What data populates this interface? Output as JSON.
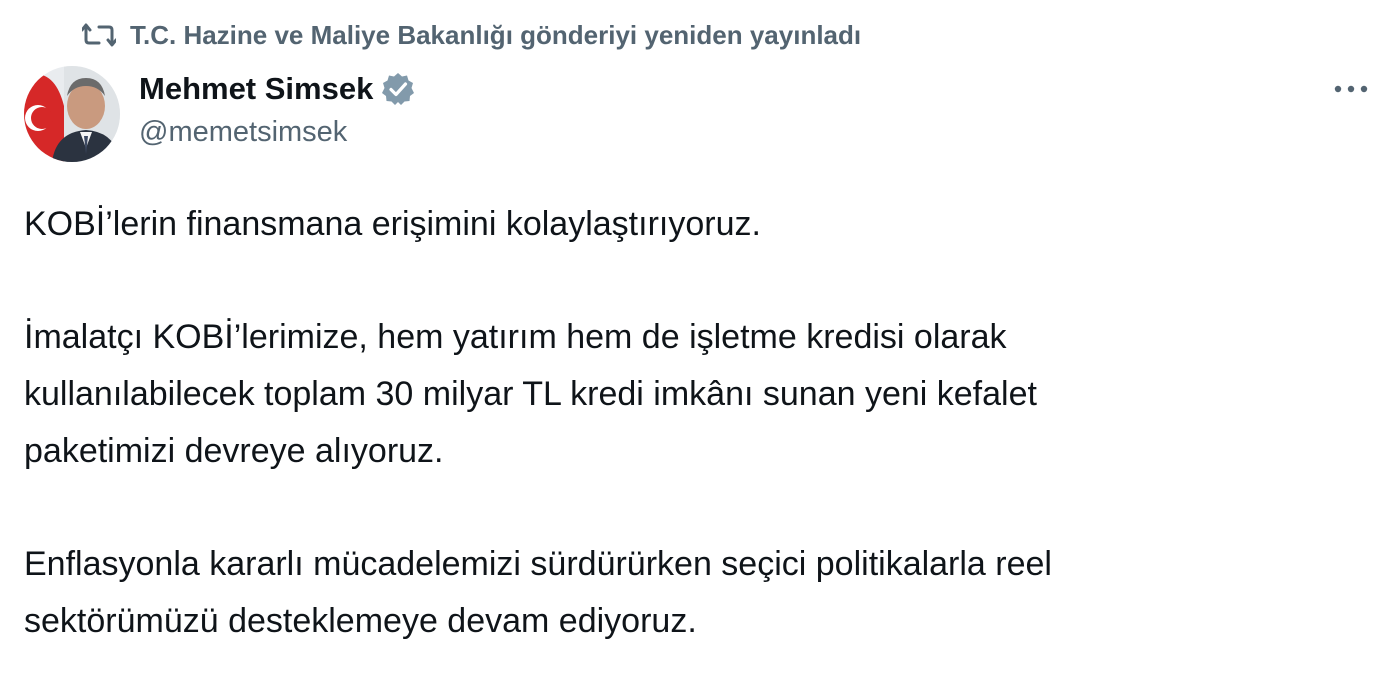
{
  "repost": {
    "icon": "repost-icon",
    "text": "T.C. Hazine ve Maliye Bakanlığı gönderiyi yeniden yayınladı"
  },
  "author": {
    "name": "Mehmet Simsek",
    "handle": "@memetsimsek",
    "verified": true,
    "verified_color": "#829aab"
  },
  "more_icon": "more-horizontal-icon",
  "tweet": {
    "paragraph1": "KOBİ’lerin finansmana erişimini kolaylaştırıyoruz.",
    "paragraph2_line1": "İmalatçı KOBİ’lerimize, hem yatırım hem de işletme kredisi olarak",
    "paragraph2_line2": "kullanılabilecek toplam 30 milyar TL kredi imkânı sunan yeni kefalet",
    "paragraph2_line3": "paketimizi devreye alıyoruz.",
    "paragraph3_line1": "Enflasyonla kararlı mücadelemizi sürdürürken seçici politikalarla reel",
    "paragraph3_line2": "sektörümüzü desteklemeye devam ediyoruz."
  },
  "colors": {
    "text_primary": "#0f1419",
    "text_secondary": "#536471",
    "background": "#ffffff"
  }
}
